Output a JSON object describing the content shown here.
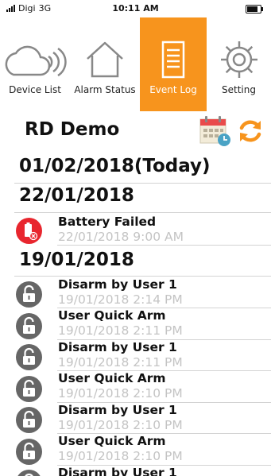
{
  "status_bar": {
    "carrier": "Digi",
    "network": "3G",
    "time": "10:11 AM",
    "battery_level": 0.8
  },
  "tabs": [
    {
      "label": "Device List",
      "icon": "cloud-signal-icon",
      "active": false
    },
    {
      "label": "Alarm Status",
      "icon": "house-icon",
      "active": false
    },
    {
      "label": "Event Log",
      "icon": "document-icon",
      "active": true
    },
    {
      "label": "Setting",
      "icon": "gear-icon",
      "active": false
    }
  ],
  "header": {
    "site_name": "RD Demo",
    "calendar_icon": "calendar-icon",
    "refresh_icon": "refresh-icon"
  },
  "colors": {
    "accent": "#f7941d",
    "alarm": "#e8262e",
    "lock": "#666666",
    "time_text": "#c4c4c4"
  },
  "groups": [
    {
      "date": "01/02/2018(Today)",
      "events": []
    },
    {
      "date": "22/01/2018",
      "events": [
        {
          "title": "Battery Failed",
          "time": "22/01/2018 9:00 AM",
          "icon": "battery-alert-icon"
        }
      ]
    },
    {
      "date": "19/01/2018",
      "events": [
        {
          "title": "Disarm by User 1",
          "time": "19/01/2018 2:14 PM",
          "icon": "unlock-icon"
        },
        {
          "title": "User Quick Arm",
          "time": "19/01/2018 2:11 PM",
          "icon": "lock-icon"
        },
        {
          "title": "Disarm by User 1",
          "time": "19/01/2018 2:11 PM",
          "icon": "unlock-icon"
        },
        {
          "title": "User Quick Arm",
          "time": "19/01/2018 2:10 PM",
          "icon": "lock-icon"
        },
        {
          "title": "Disarm by User 1",
          "time": "19/01/2018 2:10 PM",
          "icon": "unlock-icon"
        },
        {
          "title": "User Quick Arm",
          "time": "19/01/2018 2:10 PM",
          "icon": "lock-icon"
        },
        {
          "title": "Disarm by User 1",
          "time": "",
          "icon": "unlock-icon"
        }
      ]
    }
  ]
}
